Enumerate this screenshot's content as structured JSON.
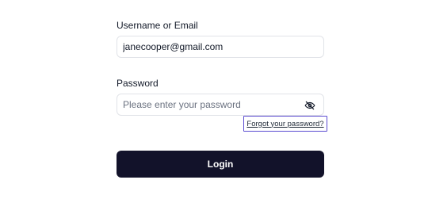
{
  "form": {
    "username": {
      "label": "Username or Email",
      "value": "janecooper@gmail.com"
    },
    "password": {
      "label": "Password",
      "placeholder": "Please enter your password",
      "value": "",
      "toggle_icon": "eye-off-icon"
    },
    "forgot_password_link": "Forgot your password?",
    "login_button": "Login"
  },
  "colors": {
    "button_bg": "#12122a",
    "focus_ring": "#5b4cd1",
    "input_border": "#e1e3e8"
  }
}
